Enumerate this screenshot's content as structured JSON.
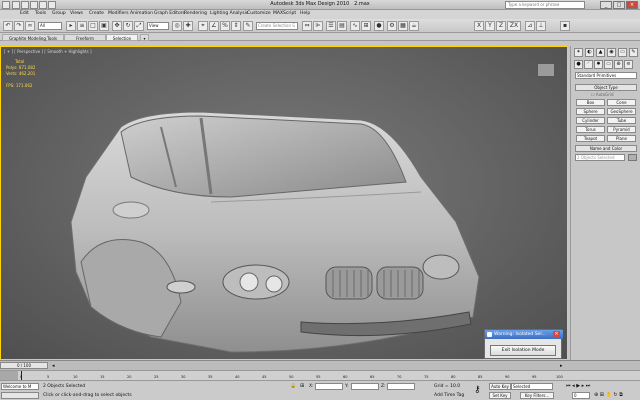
{
  "title_bar": {
    "title": "Autodesk 3ds Max Design 2010",
    "file": "2.max",
    "search_placeholder": "Type a keyword or phrase"
  },
  "menu": [
    "Edit",
    "Tools",
    "Group",
    "Views",
    "Create",
    "Modifiers",
    "Animation",
    "Graph Editors",
    "Rendering",
    "Lighting Analysis",
    "Customize",
    "MAXScript",
    "Help"
  ],
  "toolbar": {
    "filter_value": "All",
    "view_value": "View",
    "selection_set_placeholder": "Create Selection S"
  },
  "ribbon_tabs": [
    "Graphite Modeling Tools",
    "Freeform",
    "Selection"
  ],
  "viewport": {
    "label": "[ + ] [ Perspective ] [ Smooth + Highlights ]",
    "stats": {
      "header": "Total",
      "polys_label": "Polys:",
      "polys_value": "871,082",
      "verts_label": "Verts:",
      "verts_value": "462,201",
      "fps_label": "FPS:",
      "fps_value": "171.062"
    }
  },
  "command_panel": {
    "category_select": "Standard Primitives",
    "object_type_header": "Object Type",
    "autogrid": "AutoGrid",
    "primitives": [
      "Box",
      "Cone",
      "Sphere",
      "GeoSphere",
      "Cylinder",
      "Tube",
      "Torus",
      "Pyramid",
      "Teapot",
      "Plane"
    ],
    "name_color_header": "Name and Color",
    "name_value": "2 Objects Selected"
  },
  "dialog": {
    "title": "Warning: Isolated Sel...",
    "button": "Exit Isolation Mode"
  },
  "timeline": {
    "frame": "0 / 100",
    "ticks": [
      "0",
      "5",
      "10",
      "15",
      "20",
      "25",
      "30",
      "35",
      "40",
      "45",
      "50",
      "55",
      "60",
      "65",
      "70",
      "75",
      "80",
      "85",
      "90",
      "95",
      "100"
    ]
  },
  "status": {
    "maxscript": "Welcome to M",
    "selected": "2 Objects Selected",
    "prompt": "Click or click-and-drag to select objects",
    "x_label": "X:",
    "y_label": "Y:",
    "z_label": "Z:",
    "grid": "Grid = 10.0",
    "add_time_tag": "Add Time Tag",
    "auto_key": "Auto Key",
    "set_key": "Set Key",
    "selected_dropdown": "Selected",
    "key_filters": "Key Filters...",
    "frame_field": "0"
  },
  "colors": {
    "viewport_border": "#ffd200",
    "stats_text": "#ffd94a",
    "dialog_title": "#3c6fc4"
  }
}
